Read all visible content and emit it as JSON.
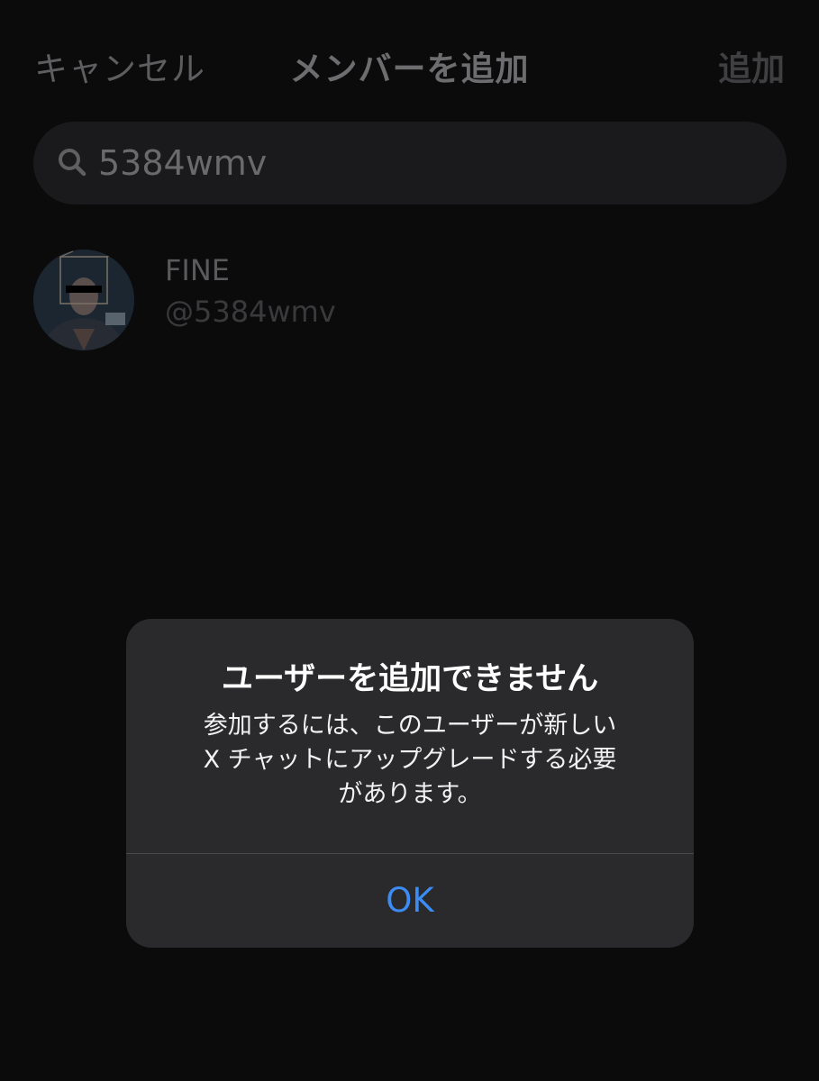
{
  "nav": {
    "cancel_label": "キャンセル",
    "title": "メンバーを追加",
    "add_label": "追加"
  },
  "search": {
    "icon": "search-icon",
    "value": "5384wmv"
  },
  "results": [
    {
      "name": "FINE",
      "handle": "@5384wmv"
    }
  ],
  "alert": {
    "title": "ユーザーを追加できません",
    "message_lines": [
      "参加するには、このユーザーが新しい",
      "X チャットにアップグレードする必要",
      "があります。"
    ],
    "ok_label": "OK"
  },
  "colors": {
    "background": "#0b0b0c",
    "alert_background": "#2a2a2c",
    "accent": "#3b8cf4"
  }
}
